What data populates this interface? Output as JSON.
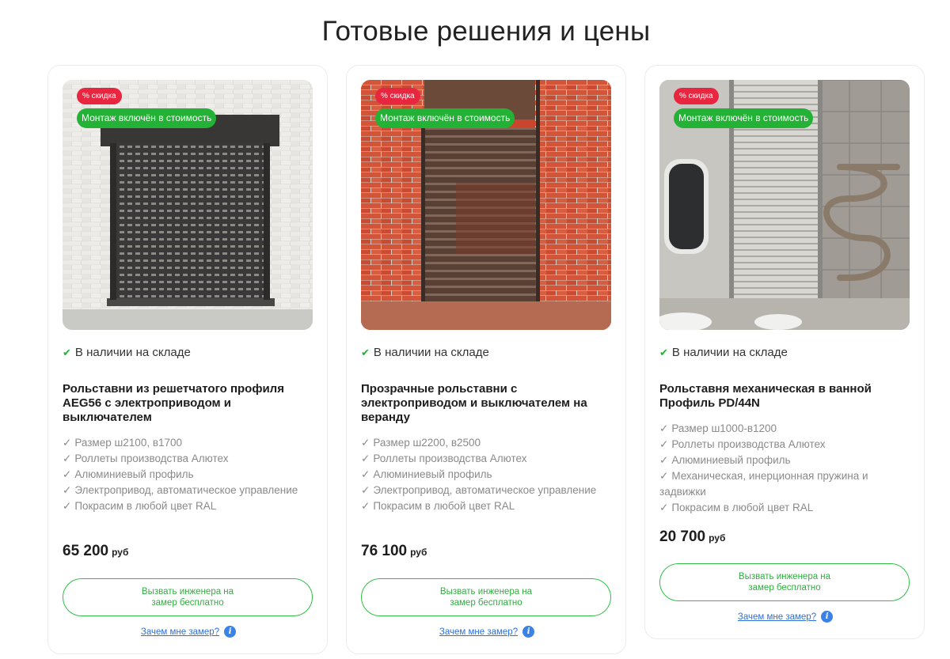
{
  "page": {
    "title": "Готовые решения и цены"
  },
  "colors": {
    "accent_green": "#23b236",
    "badge_red": "#e8263f",
    "link_blue": "#2f6fd8"
  },
  "products": [
    {
      "discount_badge": "% скидка",
      "install_badge": "Монтаж включён в стоимость",
      "stock": "В наличии на складе",
      "title": "Рольставни из решетчатого профиля AEG56 с электроприводом и выключателем",
      "features": [
        "Размер ш2100, в1700",
        "Роллеты производства Алютех",
        "Алюминиевый профиль",
        "Электропривод, автоматическое управление",
        "Покрасим в любой цвет RAL"
      ],
      "price": "65 200",
      "currency": "руб",
      "cta": "Вызвать инженера на замер бесплатно",
      "why_link": "Зачем мне замер?"
    },
    {
      "discount_badge": "% скидка",
      "install_badge": "Монтаж включён в стоимость",
      "stock": "В наличии на складе",
      "title": "Прозрачные рольставни с электроприводом и выключателем на веранду",
      "features": [
        "Размер ш2200, в2500",
        "Роллеты производства Алютех",
        "Алюминиевый профиль",
        "Электропривод, автоматическое управление",
        "Покрасим в любой цвет RAL"
      ],
      "price": "76 100",
      "currency": "руб",
      "cta": "Вызвать инженера на замер бесплатно",
      "why_link": "Зачем мне замер?"
    },
    {
      "discount_badge": "% скидка",
      "install_badge": "Монтаж включён в стоимость",
      "stock": "В наличии на складе",
      "title": "Рольставня механическая в ванной Профиль PD/44N",
      "features": [
        "Размер ш1000-в1200",
        "Роллеты производства Алютех",
        "Алюминиевый профиль",
        "Механическая, инерционная пружина и задвижки",
        "Покрасим в любой цвет RAL"
      ],
      "price": "20 700",
      "currency": "руб",
      "cta": "Вызвать инженера на замер бесплатно",
      "why_link": "Зачем мне замер?"
    }
  ]
}
